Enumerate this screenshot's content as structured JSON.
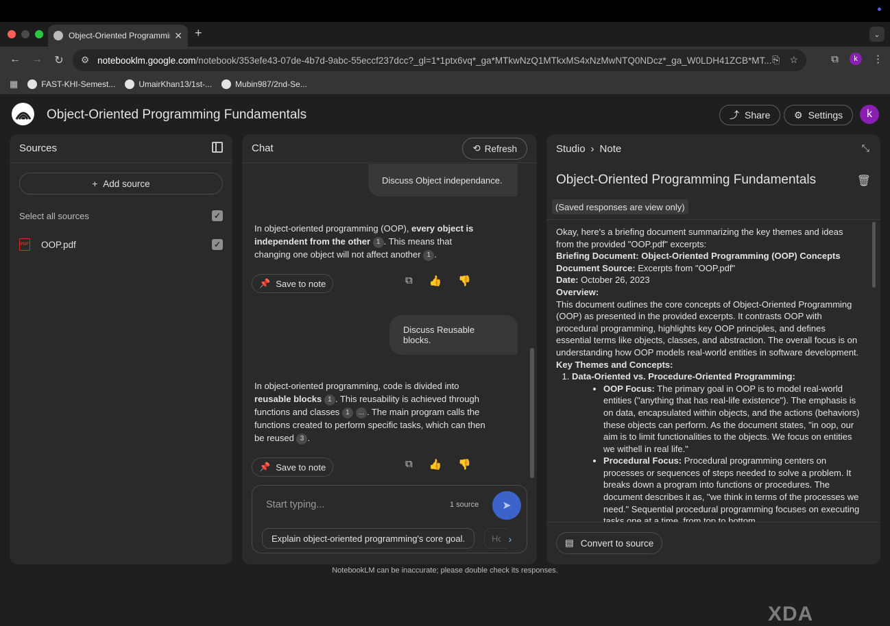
{
  "browser": {
    "tab_title": "Object-Oriented Programming Fundamentals",
    "tab_close": "✕",
    "new_tab": "+",
    "url_host": "notebooklm.google.com",
    "url_rest": "/notebook/353efe43-07de-4b7d-9abc-55eccf237dcc?_gl=1*1ptx6vq*_ga*MTkwNzQ1MTkxMS4xNzMwNTQ0NDcz*_ga_W0LDH41ZCB*MT...",
    "profile_initial": "k",
    "bookmarks": [
      "FAST-KHI-Semest...",
      "UmairKhan13/1st-...",
      "Mubin987/2nd-Se..."
    ]
  },
  "header": {
    "title": "Object-Oriented Programming Fundamentals",
    "share_label": "Share",
    "settings_label": "Settings",
    "avatar_initial": "k"
  },
  "sources": {
    "title": "Sources",
    "add_label": "Add source",
    "select_all_label": "Select all sources",
    "items": [
      {
        "name": "OOP.pdf",
        "icon": "PDF"
      }
    ]
  },
  "chat": {
    "title": "Chat",
    "refresh_label": "Refresh",
    "messages": [
      {
        "user": "Discuss Object independance."
      },
      {
        "p1": "In object-oriented programming (OOP), ",
        "b1": "every object is independent from the other",
        "c1": "1",
        "p2": ". This means that changing one object will not affect another ",
        "c2": "1",
        "p3": "."
      },
      {
        "user": "Discuss Reusable blocks."
      },
      {
        "p1": "In object-oriented programming, code is divided into ",
        "b1": "reusable blocks",
        "c1": "1",
        "p2": ". This reusability is achieved through functions and classes ",
        "c2": "1",
        "c3": "...",
        "p3": ". The main program calls the functions created to perform specific tasks, which can then be reused ",
        "c4": "3",
        "p4": "."
      }
    ],
    "save_label": "Save to note",
    "placeholder": "Start typing...",
    "source_count": "1 source",
    "suggestion": "Explain object-oriented programming's core goal.",
    "suggestion2": "Ho"
  },
  "studio": {
    "crumb1": "Studio",
    "crumb2": "Note",
    "note_title": "Object-Oriented Programming Fundamentals",
    "view_only": "(Saved responses are view only)",
    "intro": "Okay, here's a briefing document summarizing the key themes and ideas from the provided \"OOP.pdf\" excerpts:",
    "doc_title": "Briefing Document: Object-Oriented Programming (OOP) Concepts",
    "source_label": "Document Source:",
    "source_value": " Excerpts from \"OOP.pdf\"",
    "date_label": "Date:",
    "date_value": " October 26, 2023",
    "overview_label": "Overview:",
    "overview": "This document outlines the core concepts of Object-Oriented Programming (OOP) as presented in the provided excerpts. It contrasts OOP with procedural programming, highlights key OOP principles, and defines essential terms like objects, classes, and abstraction. The overall focus is on understanding how OOP models real-world entities in software development.",
    "themes_label": "Key Themes and Concepts:",
    "item1": "Data-Oriented vs. Procedure-Oriented Programming:",
    "b1_label": "OOP Focus:",
    "b1_text": " The primary goal in OOP is to model real-world entities (\"anything that has real-life existence\"). The emphasis is on data, encapsulated within objects, and the actions (behaviors) these objects can perform. As the document states, \"in oop, our aim is to limit functionalities to the objects. We focus on entities we withell in real life.\"",
    "b2_label": "Procedural Focus:",
    "b2_text": " Procedural programming centers on processes or sequences of steps needed to solve a problem. It breaks down a program into functions or procedures. The document describes it as, \"we think in terms of the processes we need.\" Sequential procedural programming focuses on executing tasks one at a time, from top to bottom.",
    "convert_label": "Convert to source"
  },
  "footer": "NotebookLM can be inaccurate; please double check its responses.",
  "watermark": "XDA",
  "colors": {
    "accent": "#3b63c9",
    "avatar": "#8a1fb4",
    "panel": "#2a2a2a",
    "background": "#1f1f1f"
  }
}
